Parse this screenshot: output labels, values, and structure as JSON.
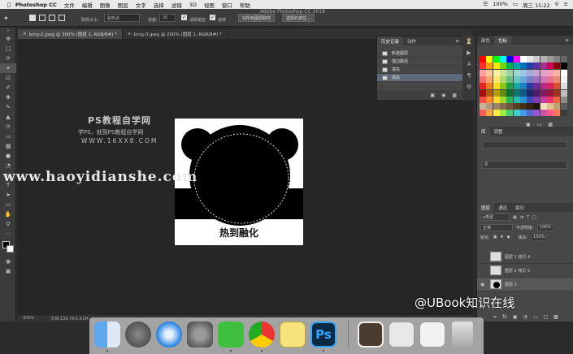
{
  "menubar": {
    "app": "Photoshop CC",
    "items": [
      "文件",
      "编辑",
      "图像",
      "图层",
      "文字",
      "选择",
      "滤镜",
      "3D",
      "视图",
      "窗口",
      "帮助"
    ],
    "battery": "100%",
    "clock": "周三 15:22"
  },
  "window_title": "Adobe Photoshop CC 2018",
  "options": {
    "size_label": "取样大小:",
    "size_value": "取样点",
    "tolerance_label": "容差:",
    "tolerance_value": "20",
    "antialias_label": "消除锯齿",
    "contiguous_label": "连续",
    "all_layers_btn": "对所有图层取样",
    "select_subject_btn": "选择并遮住..."
  },
  "tabs": [
    {
      "label": "bmg-2.jpeg @ 300% (图层 2, RGB/8#) *"
    },
    {
      "label": "bmg-3.jpeg @ 200% (图层 1, RGB/8#) *"
    }
  ],
  "canvas": {
    "caption": "热到融化",
    "watermark_title": "PS教程自学网",
    "watermark_sub": "学PS，就到PS教程自学网",
    "watermark_url": "WWW.16XX8.COM",
    "overlay_url": "www.haoyidianshe.com"
  },
  "history": {
    "tabs": [
      "历史记录",
      "动作"
    ],
    "items": [
      "新建图层",
      "描边路径",
      "填充",
      "填充"
    ],
    "selected_index": 3
  },
  "right_panel": {
    "color_tabs": [
      "颜色",
      "色板"
    ],
    "library_tabs": [
      "库",
      "调整"
    ],
    "layer_tabs": [
      "图层",
      "通道",
      "路径"
    ],
    "kind_label": "ρ类型",
    "blend_mode": "正常",
    "opacity_label": "不透明度:",
    "opacity_value": "100%",
    "lock_label": "锁定:",
    "fill_label": "填充:",
    "fill_value": "100%",
    "layers": [
      {
        "name": "图层 1 拷贝 4",
        "selected": false
      },
      {
        "name": "图层 1 拷贝 5",
        "selected": false
      },
      {
        "name": "图层 2",
        "selected": true
      }
    ]
  },
  "status": {
    "zoom": "300%",
    "doc_info": "文档:136.7K/1.61M"
  },
  "overlay_brand": "@UBook知识在线",
  "dock": {
    "apps": [
      "finder-icon",
      "launchpad-icon",
      "safari-icon",
      "system-preferences-icon",
      "wechat-icon",
      "chrome-icon",
      "notes-icon",
      "photoshop-icon",
      "photo-icon",
      "window-thumb-icon",
      "window-thumb-2-icon",
      "trash-icon"
    ],
    "ps_label": "Ps"
  },
  "swatch_colors": [
    [
      "#ff0000",
      "#ffff00",
      "#00ff00",
      "#00ffff",
      "#0000ff",
      "#ff00ff",
      "#ffffff",
      "#e6e6e6",
      "#cccccc",
      "#b3b3b3",
      "#999999",
      "#808080",
      "#666666"
    ],
    [
      "#ff3030",
      "#ff9a00",
      "#ffe600",
      "#72d400",
      "#00b04c",
      "#00a6a6",
      "#0070c0",
      "#1f3fa0",
      "#5a2fa0",
      "#a02f8f",
      "#d2005c",
      "#8a0000",
      "#000000"
    ],
    [
      "#f7a1a1",
      "#f9c89b",
      "#fdf19e",
      "#c9e69a",
      "#9ed3a6",
      "#9ed7d3",
      "#9ec4e6",
      "#a3a9d6",
      "#c1a2d3",
      "#e0a3cb",
      "#f2a0b8",
      "#f4b2a2",
      "#ffffff"
    ],
    [
      "#f47070",
      "#f6a66a",
      "#fbe96c",
      "#afd96a",
      "#6cc07e",
      "#6cc6c1",
      "#6aa8d9",
      "#7580c2",
      "#a272c0",
      "#d473b6",
      "#ea6f94",
      "#ea8c72",
      "#f2f2f2"
    ],
    [
      "#e62222",
      "#ee7d1c",
      "#f6dc1a",
      "#8bc61c",
      "#1d9f46",
      "#1aa6a3",
      "#1a7fc4",
      "#2a3a9c",
      "#6e2a99",
      "#b52a8b",
      "#d9225e",
      "#d9502a",
      "#dcdcdc"
    ],
    [
      "#a80f0f",
      "#b25a10",
      "#b59f0f",
      "#5f8d10",
      "#0f6f2f",
      "#0f7471",
      "#0f5a8a",
      "#1b2870",
      "#4b1c6d",
      "#801d63",
      "#9a1641",
      "#9a371c",
      "#bdbdbd"
    ],
    [
      "#ff4b4b",
      "#ff8c2b",
      "#ffd82b",
      "#9cd92b",
      "#2bb35c",
      "#2bb8b4",
      "#2b93d4",
      "#3c4ab3",
      "#7f3cb0",
      "#c43ca0",
      "#ec336d",
      "#ec643c",
      "#8c8c8c"
    ],
    [
      "#c9b29a",
      "#b39a7f",
      "#9c8266",
      "#86694f",
      "#705338",
      "#5a3e24",
      "#45301a",
      "#332312",
      "#22170b",
      "#f0e0c0",
      "#e0c090",
      "#c0a070",
      "#5c5c5c"
    ],
    [
      "#ff5a5a",
      "#ffaa44",
      "#ffee44",
      "#99ee44",
      "#44cc77",
      "#44cccc",
      "#4499ee",
      "#5566cc",
      "#9955cc",
      "#cc55aa",
      "#ff5588",
      "#ff7755",
      "#3c3c3c"
    ]
  ]
}
